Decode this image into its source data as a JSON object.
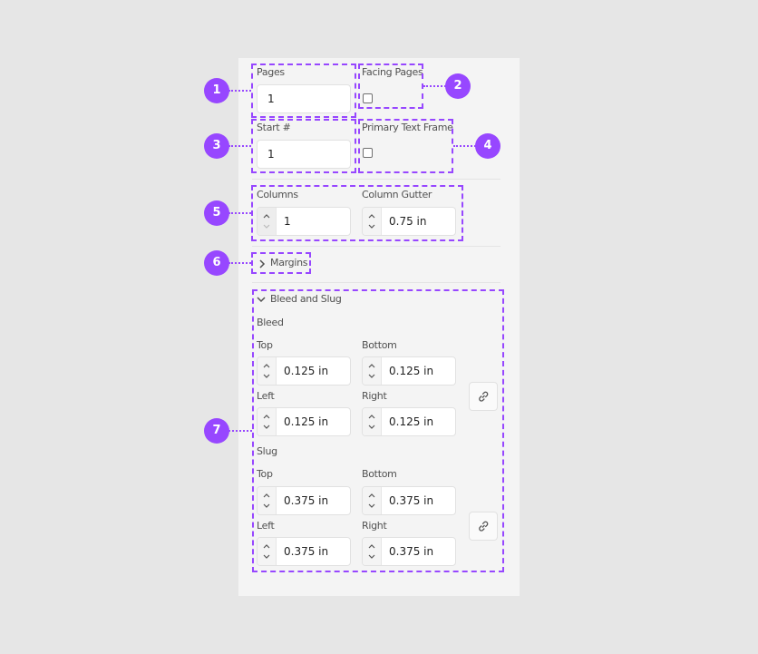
{
  "document_setup": {
    "pages": {
      "label": "Pages",
      "value": "1"
    },
    "facing_pages": {
      "label": "Facing Pages",
      "checked": false
    },
    "start_number": {
      "label": "Start #",
      "value": "1"
    },
    "primary_text_frame": {
      "label": "Primary Text Frame",
      "checked": false
    },
    "columns": {
      "label": "Columns",
      "value": "1"
    },
    "column_gutter": {
      "label": "Column Gutter",
      "value": "0.75 in"
    },
    "margins": {
      "label": "Margins",
      "expanded": false
    },
    "bleed_and_slug": {
      "label": "Bleed and Slug",
      "expanded": true,
      "bleed": {
        "label": "Bleed",
        "top": {
          "label": "Top",
          "value": "0.125 in"
        },
        "bottom": {
          "label": "Bottom",
          "value": "0.125 in"
        },
        "left": {
          "label": "Left",
          "value": "0.125 in"
        },
        "right": {
          "label": "Right",
          "value": "0.125 in"
        },
        "link_icon": "link-icon"
      },
      "slug": {
        "label": "Slug",
        "top": {
          "label": "Top",
          "value": "0.375 in"
        },
        "bottom": {
          "label": "Bottom",
          "value": "0.375 in"
        },
        "left": {
          "label": "Left",
          "value": "0.375 in"
        },
        "right": {
          "label": "Right",
          "value": "0.375 in"
        },
        "link_icon": "link-icon"
      }
    }
  },
  "annotations": {
    "color": "#9747ff",
    "badges": [
      "1",
      "2",
      "3",
      "4",
      "5",
      "6",
      "7"
    ]
  }
}
